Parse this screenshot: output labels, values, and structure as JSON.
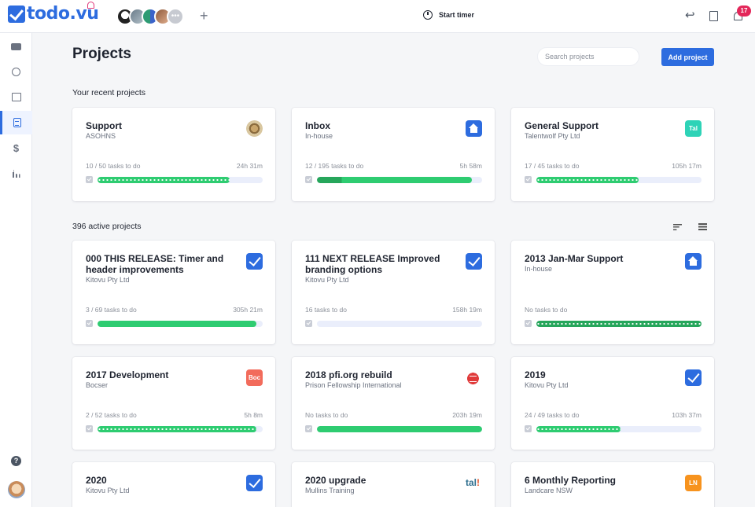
{
  "app": {
    "logo_text": "todo.vu",
    "timer_label": "Start timer",
    "notifications_count": "17"
  },
  "topbar_icons": [
    "undo-icon",
    "book-icon",
    "bell-icon",
    "stopwatch-icon",
    "add-icon"
  ],
  "sidebar_icons": [
    "board-icon",
    "clock-icon",
    "building-icon",
    "clipboard-icon",
    "dollar-icon",
    "bar-chart-icon",
    "help-icon",
    "user-avatar"
  ],
  "page": {
    "title": "Projects",
    "search_placeholder": "Search projects",
    "add_button": "Add project",
    "recent_label": "Your recent projects",
    "active_label": "396 active projects"
  },
  "recent_projects": [
    {
      "title": "Support",
      "client": "ASOHNS",
      "tasks": "10 / 50 tasks to do",
      "time": "24h 31m",
      "progress": 0.8,
      "icon": "leaf-badge"
    },
    {
      "title": "Inbox",
      "client": "In-house",
      "tasks": "12 / 195 tasks to do",
      "time": "5h 58m",
      "progress": 0.94,
      "icon": "home-icon"
    },
    {
      "title": "General Support",
      "client": "Talentwolf Pty Ltd",
      "tasks": "17 / 45 tasks to do",
      "time": "105h 17m",
      "progress": 0.62,
      "icon": "Tal",
      "icon_color": "#2ed3b7"
    }
  ],
  "active_projects": [
    {
      "title": "000 THIS RELEASE: Timer and header improvements",
      "client": "Kitovu Pty Ltd",
      "tasks": "3 / 69 tasks to do",
      "time": "305h 21m",
      "progress": 0.96,
      "icon": "check-icon"
    },
    {
      "title": "111 NEXT RELEASE Improved branding options",
      "client": "Kitovu Pty Ltd",
      "tasks": "16 tasks to do",
      "time": "158h 19m",
      "progress": 0.0,
      "icon": "check-icon"
    },
    {
      "title": "2013 Jan-Mar Support",
      "client": "In-house",
      "tasks": "No tasks to do",
      "time": "",
      "progress": 1.0,
      "icon": "home-icon"
    },
    {
      "title": "2017 Development",
      "client": "Bocser",
      "tasks": "2 / 52 tasks to do",
      "time": "5h 8m",
      "progress": 0.96,
      "icon": "Boc",
      "icon_color": "#f26b5b"
    },
    {
      "title": "2018 pfi.org rebuild",
      "client": "Prison Fellowship International",
      "tasks": "No tasks to do",
      "time": "203h 19m",
      "progress": 1.0,
      "icon": "globe-icon"
    },
    {
      "title": "2019",
      "client": "Kitovu Pty Ltd",
      "tasks": "24 / 49 tasks to do",
      "time": "103h 37m",
      "progress": 0.51,
      "icon": "check-icon"
    },
    {
      "title": "2020",
      "client": "Kitovu Pty Ltd",
      "tasks": "",
      "time": "",
      "progress": null,
      "icon": "check-icon"
    },
    {
      "title": "2020 upgrade",
      "client": "Mullins Training",
      "tasks": "",
      "time": "",
      "progress": null,
      "icon": "tall-logo"
    },
    {
      "title": "6 Monthly Reporting",
      "client": "Landcare NSW",
      "tasks": "",
      "time": "",
      "progress": null,
      "icon": "LN",
      "icon_color": "#f7931e"
    }
  ]
}
